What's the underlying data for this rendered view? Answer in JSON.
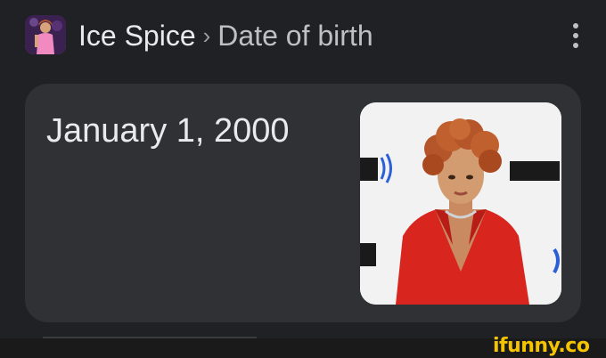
{
  "header": {
    "avatar_icon": "entity-thumbnail",
    "entity": "Ice Spice",
    "separator": "›",
    "attribute": "Date of birth",
    "menu_icon": "more-vert-icon"
  },
  "answer": {
    "value": "January 1, 2000",
    "image_icon": "entity-photo"
  },
  "watermark": {
    "text": "ifunny.co",
    "color": "#f5c400"
  },
  "colors": {
    "background": "#202124",
    "card": "#303134",
    "text": "#e8eaed",
    "secondary_text": "#bdc1c6"
  }
}
